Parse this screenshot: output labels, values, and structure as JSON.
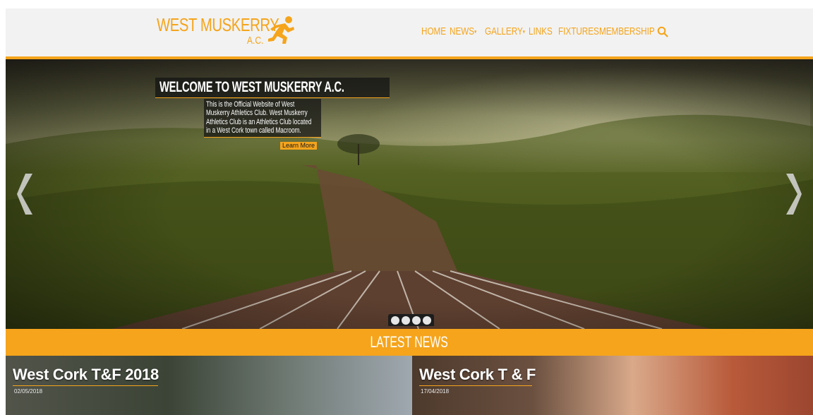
{
  "brand": {
    "name": "WEST MUSKERRY",
    "suffix": "A.C.",
    "accent": "#f5a41c",
    "icon": "runner-icon"
  },
  "nav": {
    "items": [
      {
        "label": "HOME",
        "dropdown": false
      },
      {
        "label": "NEWS",
        "dropdown": true
      },
      {
        "label": "GALLERY",
        "dropdown": true
      },
      {
        "label": "LINKS",
        "dropdown": false
      },
      {
        "label": "FIXTURES",
        "dropdown": false
      },
      {
        "label": "MEMBERSHIP",
        "dropdown": false
      }
    ],
    "caret": "▾",
    "search_icon": "search-icon"
  },
  "hero": {
    "title": "WELCOME TO WEST MUSKERRY A.C.",
    "description": "This is the Official Website of West Muskerry Athletics Club. West Muskerry Athletics Club is an Athletics Club located in a West Cork town called Macroom.",
    "cta": "Learn More",
    "slide_count": 4,
    "prev_icon": "chevron-left-icon",
    "next_icon": "chevron-right-icon"
  },
  "latest_news": {
    "heading": "LATEST NEWS",
    "cards": [
      {
        "title": "West Cork T&F 2018",
        "date": "02/05/2018"
      },
      {
        "title": "West Cork T & F",
        "date": "17/04/2018"
      }
    ]
  }
}
